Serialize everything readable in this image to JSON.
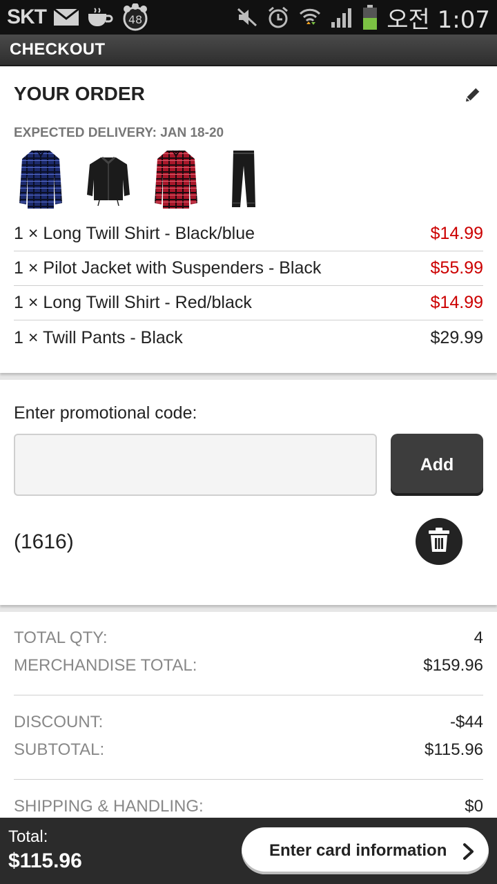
{
  "statusbar": {
    "carrier": "SKT",
    "badge": "48",
    "time": "오전 1:07",
    "icons": [
      "mail-icon",
      "cup-icon",
      "paw-badge-icon",
      "mute-icon",
      "alarm-icon",
      "wifi-icon",
      "signal-icon",
      "battery-icon"
    ]
  },
  "header": {
    "title": "CHECKOUT"
  },
  "order": {
    "title": "YOUR ORDER",
    "delivery": "EXPECTED DELIVERY: JAN 18-20",
    "thumbnails": [
      "blue-plaid-shirt",
      "black-bomber-jacket",
      "red-plaid-shirt",
      "black-pants"
    ],
    "items": [
      {
        "label": "1 × Long Twill Shirt - Black/blue",
        "price": "$14.99",
        "highlight": true
      },
      {
        "label": "1 × Pilot Jacket with Suspenders - Black",
        "price": "$55.99",
        "highlight": true
      },
      {
        "label": "1 × Long Twill Shirt - Red/black",
        "price": "$14.99",
        "highlight": true
      },
      {
        "label": "1 × Twill Pants - Black",
        "price": "$29.99",
        "highlight": false
      }
    ]
  },
  "promo": {
    "label": "Enter promotional code:",
    "input_value": "",
    "add_label": "Add",
    "applied_code": "(1616)"
  },
  "totals": {
    "total_qty_label": "TOTAL QTY:",
    "total_qty_value": "4",
    "merch_label": "MERCHANDISE TOTAL:",
    "merch_value": "$159.96",
    "discount_label": "DISCOUNT:",
    "discount_value": "-$44",
    "subtotal_label": "SUBTOTAL:",
    "subtotal_value": "$115.96",
    "shipping_label": "SHIPPING & HANDLING:",
    "shipping_value": "$0"
  },
  "footer": {
    "total_label": "Total:",
    "total_value": "$115.96",
    "card_button": "Enter card information"
  },
  "colors": {
    "accent_price": "#cc0000",
    "bar": "#2b2b2b"
  }
}
